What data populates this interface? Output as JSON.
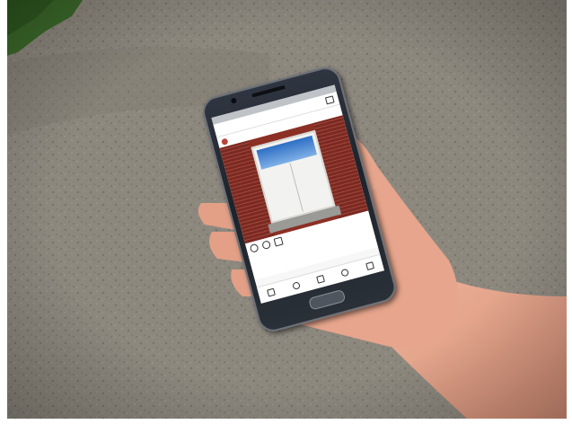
{
  "scene": {
    "description_items": [
      "gravel-ground",
      "grass-patch",
      "hand",
      "smartphone"
    ],
    "colors": {
      "gravel": "#8f8a80",
      "grass": "#3c6a2a",
      "skin": "#e6a58c",
      "phone_body": "#262b33",
      "brick": "#8c2f24",
      "door": "#f2f2f0",
      "window_sky": "#2e6fc4"
    }
  },
  "phone_screen": {
    "icons": [
      "inbox-icon",
      "heart-icon",
      "comment-icon",
      "share-icon",
      "home-icon",
      "search-icon",
      "camera-icon",
      "activity-icon",
      "profile-icon"
    ]
  }
}
